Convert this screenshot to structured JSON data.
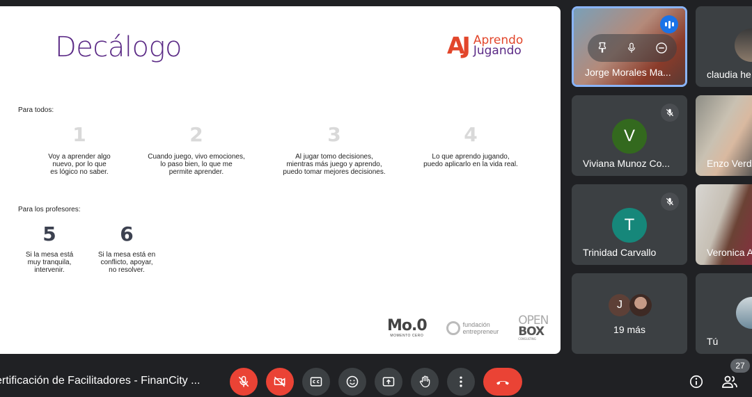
{
  "slide": {
    "title": "Decálogo",
    "logo": {
      "mark": "AJ",
      "line1": "Aprendo",
      "line2": "Jugando"
    },
    "section_all": "Para todos:",
    "items_all": [
      {
        "num": "1",
        "text": "Voy a aprender algo\nnuevo, por lo que\nes lógico no saber."
      },
      {
        "num": "2",
        "text": "Cuando juego, vivo emociones,\nlo paso bien, lo que me\npermite aprender."
      },
      {
        "num": "3",
        "text": "Al jugar tomo decisiones,\nmientras más juego y aprendo,\npuedo tomar mejores decisiones."
      },
      {
        "num": "4",
        "text": "Lo que aprendo jugando,\npuedo aplicarlo en la vida real."
      }
    ],
    "section_teachers": "Para los profesores:",
    "items_teachers": [
      {
        "num": "5",
        "text": "Si la mesa está\nmuy tranquila,\nintervenir."
      },
      {
        "num": "6",
        "text": "Si la mesa está en\nconflicto, apoyar,\nno resolver."
      }
    ],
    "footer": {
      "mo0_big": "Mo.0",
      "mo0_small": "MOMENTO CERO",
      "fe_line1": "fundación",
      "fe_line2": "entrepreneur",
      "ob_line1": "OPEN",
      "ob_line2": "BOX",
      "ob_small": "CONSULTING"
    }
  },
  "participants": [
    {
      "name": "Jorge Morales Ma...",
      "speaking": true
    },
    {
      "name": "claudia he"
    },
    {
      "name": "Viviana Munoz Co...",
      "initial": "V",
      "color": "#33691e",
      "muted": true
    },
    {
      "name": "Enzo Verd"
    },
    {
      "name": "Trinidad Carvallo",
      "initial": "T",
      "color": "#16877a",
      "muted": true
    },
    {
      "name": "Veronica A"
    },
    {
      "name": "19 más",
      "initial": "J"
    },
    {
      "name": "Tú"
    }
  ],
  "bottom_bar": {
    "meeting_title": "ertificación de Facilitadores - FinanCity ...",
    "participants_count": "27"
  },
  "icons": [
    "mic-off-icon",
    "camera-off-icon",
    "captions-icon",
    "emoji-icon",
    "present-icon",
    "raise-hand-icon",
    "more-icon",
    "hangup-icon",
    "info-icon",
    "people-icon"
  ]
}
